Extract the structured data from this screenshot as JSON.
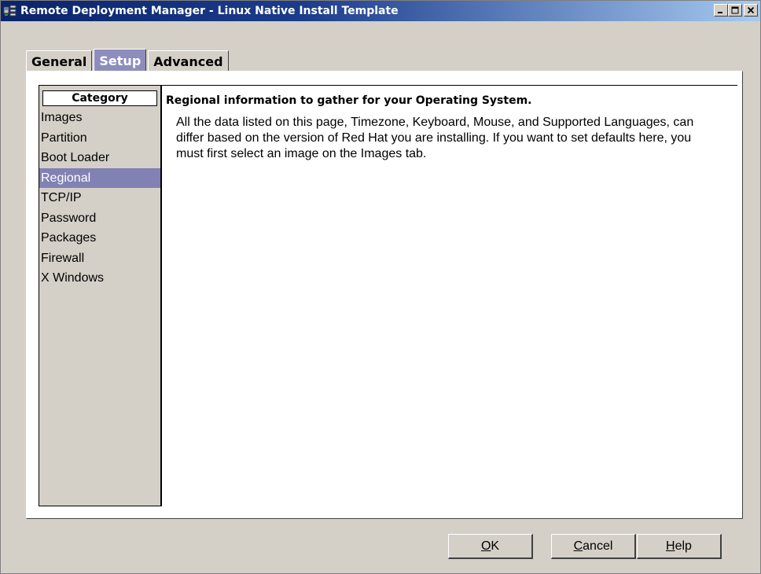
{
  "window": {
    "title": "Remote Deployment Manager - Linux Native Install Template",
    "icon": "rdm-app-icon",
    "controls": {
      "minimize": "_",
      "maximize": "□",
      "close": "×"
    }
  },
  "tabs": [
    {
      "label": "General",
      "active": false
    },
    {
      "label": "Setup",
      "active": true
    },
    {
      "label": "Advanced",
      "active": false
    }
  ],
  "sidebar": {
    "header": "Category",
    "items": [
      {
        "label": "Images",
        "selected": false
      },
      {
        "label": "Partition",
        "selected": false
      },
      {
        "label": "Boot Loader",
        "selected": false
      },
      {
        "label": "Regional",
        "selected": true
      },
      {
        "label": "TCP/IP",
        "selected": false
      },
      {
        "label": "Password",
        "selected": false
      },
      {
        "label": "Packages",
        "selected": false
      },
      {
        "label": "Firewall",
        "selected": false
      },
      {
        "label": "X Windows",
        "selected": false
      }
    ]
  },
  "content": {
    "heading": "Regional information to gather for your Operating System.",
    "body": "All the data listed on this page, Timezone, Keyboard, Mouse, and Supported Languages, can differ based on the version of Red Hat you are installing.  If you want to set defaults here, you must first select an image on the Images tab."
  },
  "buttons": {
    "ok": {
      "accel": "O",
      "rest": "K"
    },
    "cancel": {
      "accel": "C",
      "rest": "ancel"
    },
    "help": {
      "accel": "H",
      "rest": "elp"
    }
  },
  "colors": {
    "titlebar": "#0a246a",
    "selection": "#8181b3",
    "active_tab": "#8d8dbd",
    "face": "#d4d0c8"
  }
}
